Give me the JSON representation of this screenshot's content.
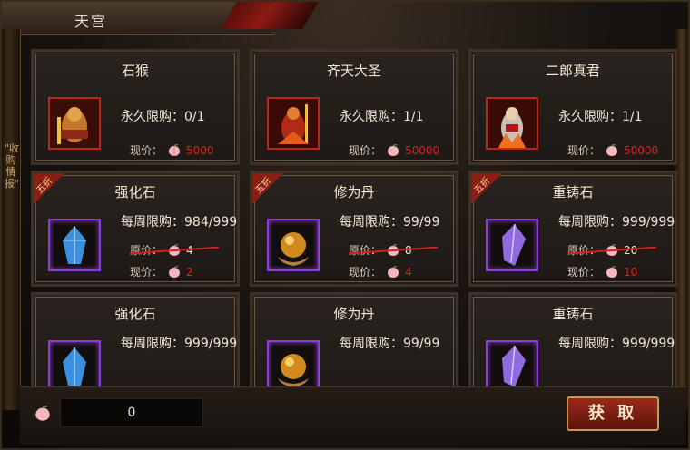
{
  "window": {
    "title": "天宫"
  },
  "sidebar": {
    "vertical_text": "\"收购情报\""
  },
  "labels": {
    "permanent_limit": "永久限购：",
    "weekly_limit": "每周限购：",
    "current_price": "现价：",
    "original_price": "原价：",
    "discount_tag": "五折"
  },
  "items": [
    {
      "name": "石猴",
      "limit": "永久限购：0/1",
      "price": "5000"
    },
    {
      "name": "齐天大圣",
      "limit": "永久限购：1/1",
      "price": "50000"
    },
    {
      "name": "二郎真君",
      "limit": "永久限购：1/1",
      "price": "50000"
    },
    {
      "name": "强化石",
      "limit": "每周限购：984/999",
      "orig_price": "4",
      "price": "2",
      "discount": "五折"
    },
    {
      "name": "修为丹",
      "limit": "每周限购：99/99",
      "orig_price": "8",
      "price": "4",
      "discount": "五折"
    },
    {
      "name": "重铸石",
      "limit": "每周限购：999/999",
      "orig_price": "20",
      "price": "10",
      "discount": "五折"
    },
    {
      "name": "强化石",
      "limit": "每周限购：999/999"
    },
    {
      "name": "修为丹",
      "limit": "每周限购：99/99"
    },
    {
      "name": "重铸石",
      "limit": "每周限购：999/999"
    }
  ],
  "footer": {
    "currency_amount": "0",
    "get_button": "获 取"
  },
  "colors": {
    "price_red": "#e02020",
    "accent_gold": "#c89a5a",
    "button_red": "#9a2a1a"
  }
}
